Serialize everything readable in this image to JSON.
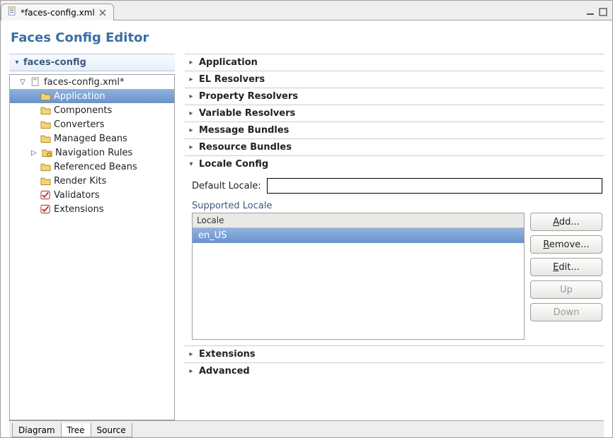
{
  "tab": {
    "title": "*faces-config.xml",
    "icon": "faces-icon"
  },
  "editor": {
    "title": "Faces Config Editor"
  },
  "tree": {
    "section_title": "faces-config",
    "root": {
      "label": "faces-config.xml*",
      "expanded": true,
      "children": [
        {
          "label": "Application",
          "icon": "folder-app",
          "selected": true
        },
        {
          "label": "Components",
          "icon": "folder"
        },
        {
          "label": "Converters",
          "icon": "folder"
        },
        {
          "label": "Managed Beans",
          "icon": "folder"
        },
        {
          "label": "Navigation Rules",
          "icon": "folder-nav",
          "has_children": true
        },
        {
          "label": "Referenced Beans",
          "icon": "folder"
        },
        {
          "label": "Render Kits",
          "icon": "folder"
        },
        {
          "label": "Validators",
          "icon": "check"
        },
        {
          "label": "Extensions",
          "icon": "check"
        }
      ]
    }
  },
  "sections": [
    {
      "title": "Application",
      "expanded": false
    },
    {
      "title": "EL Resolvers",
      "expanded": false
    },
    {
      "title": "Property Resolvers",
      "expanded": false
    },
    {
      "title": "Variable Resolvers",
      "expanded": false
    },
    {
      "title": "Message Bundles",
      "expanded": false
    },
    {
      "title": "Resource Bundles",
      "expanded": false
    },
    {
      "title": "Locale Config",
      "expanded": true,
      "default_locale_label": "Default Locale:",
      "default_locale_value": "",
      "supported_locale_label": "Supported Locale",
      "table_header": "Locale",
      "table_rows": [
        "en_US"
      ],
      "buttons": {
        "add": "Add...",
        "remove": "Remove...",
        "edit": "Edit...",
        "up": "Up",
        "down": "Down"
      }
    },
    {
      "title": "Extensions",
      "expanded": false
    },
    {
      "title": "Advanced",
      "expanded": false
    }
  ],
  "bottom_tabs": [
    {
      "label": "Diagram",
      "active": false
    },
    {
      "label": "Tree",
      "active": true
    },
    {
      "label": "Source",
      "active": false
    }
  ]
}
